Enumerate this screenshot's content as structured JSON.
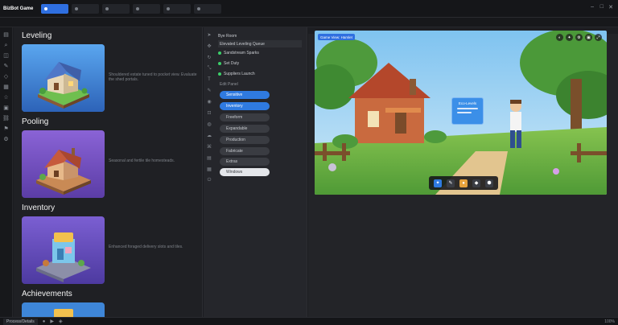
{
  "app": {
    "title": "BizBot Game"
  },
  "tabs": [
    {
      "label": "",
      "active": true
    },
    {
      "label": ""
    },
    {
      "label": ""
    },
    {
      "label": ""
    },
    {
      "label": ""
    },
    {
      "label": ""
    }
  ],
  "sections": [
    {
      "title": "Leveling",
      "desc": "Shouldered estate tuned to pocket view. Evaluate the shed portals."
    },
    {
      "title": "Pooling",
      "desc": "Seasonal and fertile tile homesteads."
    },
    {
      "title": "Inventory",
      "desc": "Enhanced foraged delivery slots and tiles."
    },
    {
      "title": "Achievements",
      "desc": ""
    }
  ],
  "properties": {
    "rows": [
      {
        "label": "Bye Room"
      },
      {
        "label": "Elevated Leveling Queue",
        "selected": true
      },
      {
        "label": "Sandstream Sparks",
        "dot": true
      },
      {
        "label": "Set Duty",
        "dot": true
      },
      {
        "label": "Suppliers Launch",
        "dot": true
      }
    ],
    "section_label": "Edit Panel",
    "buttons": [
      {
        "label": "Sensitive",
        "style": "blue"
      },
      {
        "label": "Inventory",
        "style": "blue"
      },
      {
        "label": "Freeform"
      },
      {
        "label": "Expandable"
      },
      {
        "label": "Production"
      },
      {
        "label": "Fabricate"
      },
      {
        "label": "Extras"
      },
      {
        "label": "Windows",
        "style": "white"
      }
    ]
  },
  "viewport": {
    "label": "Game View: Hamlet",
    "popup_title": "Eco-Levels",
    "tools": [
      "◐",
      "✦",
      "⚙",
      "▣",
      "⤢"
    ],
    "hotbar": [
      "✦",
      "✎",
      "●",
      "◆",
      "⬢"
    ]
  },
  "status": {
    "left_text": "Process/Details",
    "right_text": "100%"
  },
  "colors": {
    "accent": "#2f7ae0",
    "panel": "#25262b",
    "background": "#1b1c20"
  }
}
